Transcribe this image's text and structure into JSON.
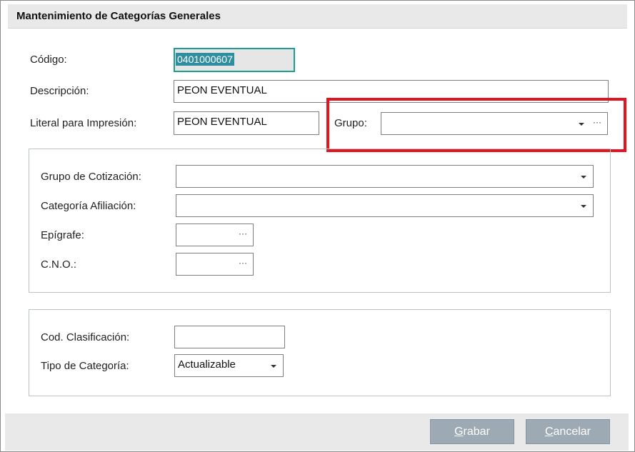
{
  "window": {
    "title": "Mantenimiento de Categorías Generales"
  },
  "fields": {
    "codigo": {
      "label": "Código:",
      "value": "0401000607"
    },
    "descripcion": {
      "label": "Descripción:",
      "value": "PEON EVENTUAL"
    },
    "literal": {
      "label": "Literal para Impresión:",
      "value": "PEON EVENTUAL"
    },
    "grupo": {
      "label": "Grupo:",
      "value": ""
    }
  },
  "section1": {
    "grupo_cotizacion": {
      "label": "Grupo de Cotización:",
      "value": ""
    },
    "categoria_afiliacion": {
      "label": "Categoría Afiliación:",
      "value": ""
    },
    "epigrafe": {
      "label": "Epígrafe:",
      "value": ""
    },
    "cno": {
      "label": "C.N.O.:",
      "value": ""
    }
  },
  "section2": {
    "cod_clasificacion": {
      "label": "Cod. Clasificación:",
      "value": ""
    },
    "tipo_categoria": {
      "label": "Tipo de Categoría:",
      "value": "Actualizable"
    }
  },
  "icons": {
    "ellipsis": "···"
  },
  "buttons": {
    "grabar": {
      "accel": "G",
      "rest": "rabar"
    },
    "cancelar": {
      "accel": "C",
      "rest": "ancelar"
    }
  },
  "colors": {
    "highlight": "#e3141f",
    "focus_border": "#1c9e94",
    "button_bg": "#9eaab3"
  }
}
